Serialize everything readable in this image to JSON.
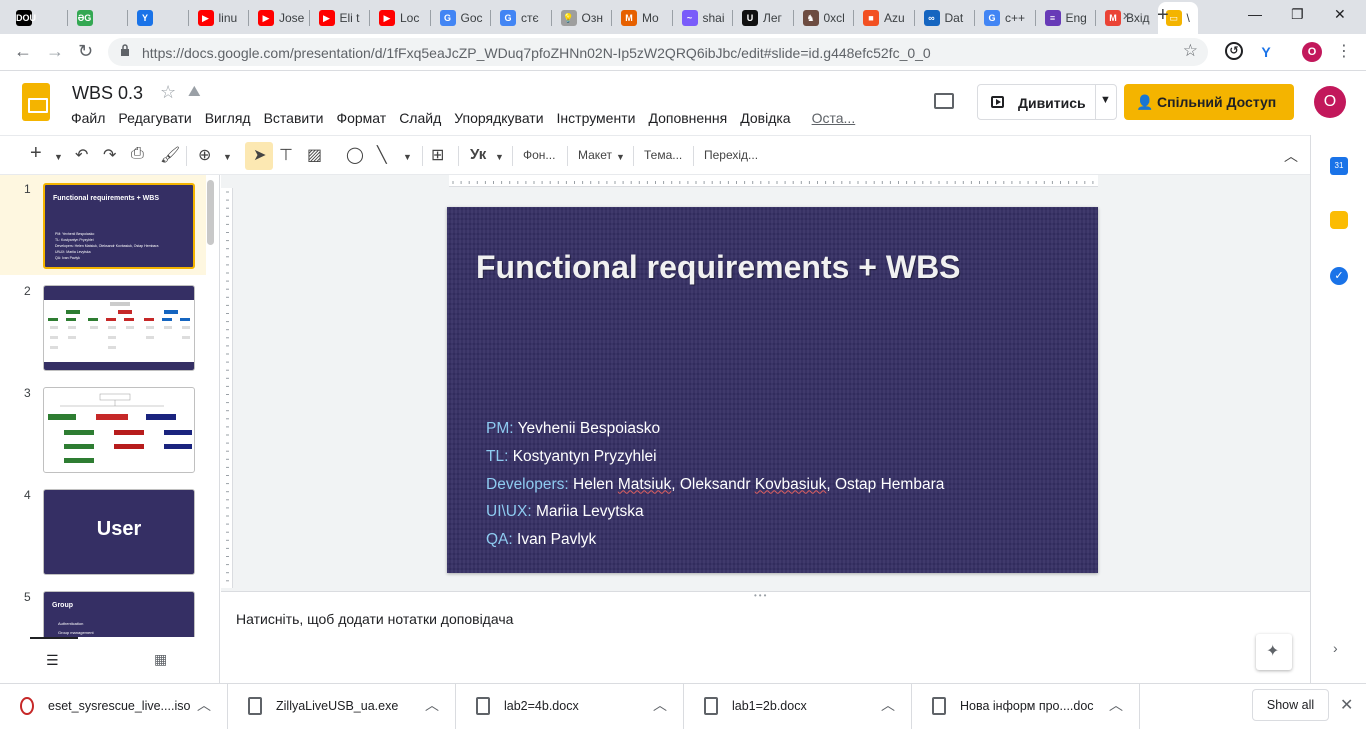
{
  "browser": {
    "tabs": [
      {
        "label": "",
        "icon": "dou-icon",
        "color": "#000000",
        "glyph": "DOU"
      },
      {
        "label": "",
        "icon": "translate-icon",
        "color": "#34a853",
        "glyph": "ƏG"
      },
      {
        "label": "",
        "icon": "y-icon",
        "color": "#1a73e8",
        "glyph": "Y"
      },
      {
        "label": "linu",
        "icon": "youtube-icon",
        "color": "#ff0000",
        "glyph": "▶"
      },
      {
        "label": "Jose",
        "icon": "youtube-icon",
        "color": "#ff0000",
        "glyph": "▶"
      },
      {
        "label": "Eli t",
        "icon": "youtube-icon",
        "color": "#ff0000",
        "glyph": "▶"
      },
      {
        "label": "Loc",
        "icon": "youtube-icon",
        "color": "#ff0000",
        "glyph": "▶"
      },
      {
        "label": "Goc",
        "icon": "google-translate-icon",
        "color": "#4285f4",
        "glyph": "G"
      },
      {
        "label": "стє",
        "icon": "google-icon",
        "color": "#4285f4",
        "glyph": "G"
      },
      {
        "label": "Озн",
        "icon": "bulb-icon",
        "color": "#9e9e9e",
        "glyph": "💡"
      },
      {
        "label": "Mo",
        "icon": "moz-icon",
        "color": "#e66000",
        "glyph": "M"
      },
      {
        "label": "shai",
        "icon": "share-icon",
        "color": "#7a5cfa",
        "glyph": "~"
      },
      {
        "label": "Лег",
        "icon": "u-icon",
        "color": "#111111",
        "glyph": "U"
      },
      {
        "label": "0xcl",
        "icon": "game-icon",
        "color": "#6d4c41",
        "glyph": "♞"
      },
      {
        "label": "Azu",
        "icon": "microsoft-icon",
        "color": "#f25022",
        "glyph": "■"
      },
      {
        "label": "Dat",
        "icon": "link-icon",
        "color": "#1565c0",
        "glyph": "∞"
      },
      {
        "label": "c++",
        "icon": "google-icon",
        "color": "#4285f4",
        "glyph": "G"
      },
      {
        "label": "Eng",
        "icon": "forms-icon",
        "color": "#673ab7",
        "glyph": "≡"
      },
      {
        "label": "Вхід",
        "icon": "gmail-icon",
        "color": "#ea4335",
        "glyph": "M"
      },
      {
        "label": "\\",
        "icon": "slides-icon",
        "color": "#f4b400",
        "glyph": "▭"
      }
    ],
    "new_tab": "+",
    "window": {
      "minimize": "—",
      "restore": "❐",
      "close": "✕"
    },
    "url": "https://docs.google.com/presentation/d/1fFxq5eaJcZP_WDuq7pfoZHNn02N-Ip5zW2QRQ6ibJbc/edit#slide=id.g448efc52fc_0_0",
    "profile_initial": "O"
  },
  "docs": {
    "title": "WBS 0.3",
    "menu": [
      "Файл",
      "Редагувати",
      "Вигляд",
      "Вставити",
      "Формат",
      "Слайд",
      "Упорядкувати",
      "Інструменти",
      "Доповнення",
      "Довідка"
    ],
    "last_edit": "Оста...",
    "present_label": "Дивитись",
    "share_label": "Спільний Доступ",
    "avatar_initial": "O"
  },
  "toolbar": {
    "font_label": "Ук",
    "background": "Фон...",
    "layout": "Макет",
    "theme": "Тема...",
    "transition": "Перехід..."
  },
  "filmstrip": {
    "slides": [
      {
        "num": "1",
        "title": "Functional requirements + WBS",
        "lines": [
          "PM: Yevhenii Bespoiasko",
          "TL: Kostyantyn Pryzyhlei",
          "Developers: Helen Matsiuk, Oleksandr Kovbasiuk, Ostap Hembara",
          "UI\\UX: Mariia Levytska",
          "QA: Ivan Pavlyk"
        ]
      },
      {
        "num": "2"
      },
      {
        "num": "3"
      },
      {
        "num": "4",
        "title": "User"
      },
      {
        "num": "5",
        "title": "Group",
        "lines": [
          "Authentication",
          "Group management"
        ]
      }
    ]
  },
  "slide": {
    "title": "Functional requirements + WBS",
    "team": [
      {
        "role": "PM:",
        "name": "Yevhenii Bespoiasko"
      },
      {
        "role": "TL:",
        "name": "Kostyantyn Pryzyhlei"
      },
      {
        "role": "Developers:",
        "name": "Helen Matsiuk, Oleksandr Kovbasiuk, Ostap Hembara"
      },
      {
        "role": "UI\\UX:",
        "name": "Mariia Levytska"
      },
      {
        "role": "QA:",
        "name": "Ivan Pavlyk"
      }
    ]
  },
  "notes": {
    "placeholder": "Натисніть, щоб додати нотатки доповідача"
  },
  "downloads": {
    "items": [
      {
        "name": "eset_sysrescue_live....iso"
      },
      {
        "name": "ZillyaLiveUSB_ua.exe"
      },
      {
        "name": "lab2=4b.docx"
      },
      {
        "name": "lab1=2b.docx"
      },
      {
        "name": "Нова інформ про....doc"
      }
    ],
    "show_all": "Show all"
  },
  "colors": {
    "accent": "#f4b400",
    "slide_bg": "#352f64",
    "role_text": "#8ecbf0",
    "avatar": "#c2185b"
  }
}
